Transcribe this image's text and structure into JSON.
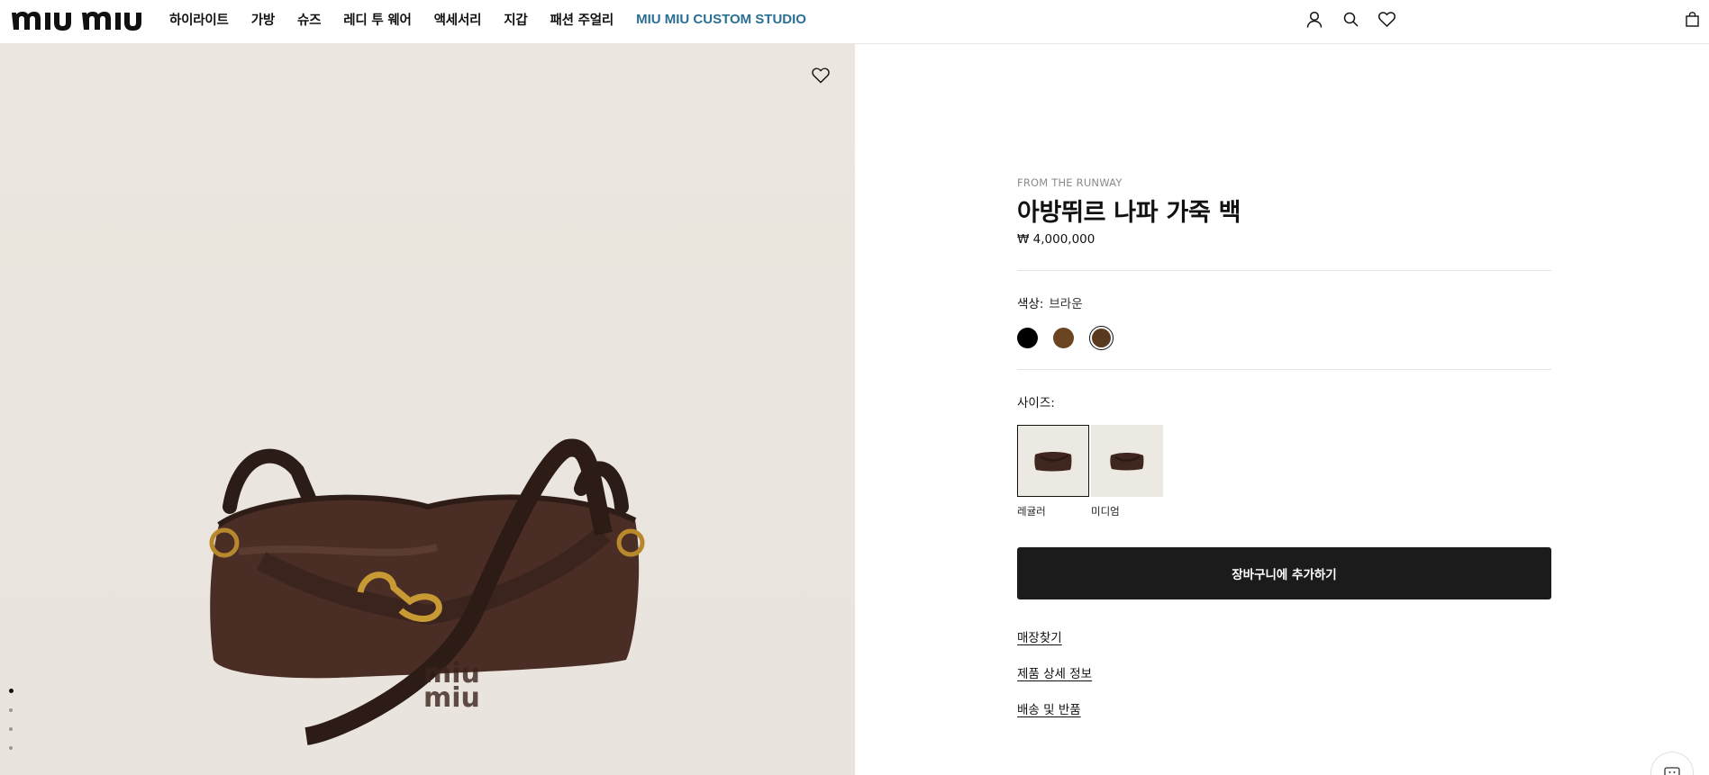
{
  "brand": {
    "logo_text": "miu miu"
  },
  "nav": {
    "items": [
      {
        "label": "하이라이트"
      },
      {
        "label": "가방"
      },
      {
        "label": "슈즈"
      },
      {
        "label": "레디 투 웨어"
      },
      {
        "label": "액세서리"
      },
      {
        "label": "지갑"
      },
      {
        "label": "패션 주얼리"
      },
      {
        "label": "MIU MIU CUSTOM STUDIO"
      }
    ],
    "accent_color": "#2b6f94"
  },
  "header_icons": [
    "account-icon",
    "search-icon",
    "wishlist-icon",
    "bag-icon"
  ],
  "gallery": {
    "dots_count": 4,
    "active_dot": 0,
    "background": "#ebe6df"
  },
  "product": {
    "eyebrow": "FROM THE RUNWAY",
    "title": "아방뛰르 나파 가죽 백",
    "price": "₩ 4,000,000",
    "color_label": "색상:",
    "color_value": "브라운",
    "swatches": [
      {
        "color": "#000000",
        "selected": false
      },
      {
        "color": "#6b4522",
        "selected": false
      },
      {
        "color": "#5a3a1f",
        "selected": true
      }
    ],
    "size_label": "사이즈:",
    "sizes": [
      {
        "label": "레귤러",
        "selected": true
      },
      {
        "label": "미디엄",
        "selected": false
      }
    ],
    "add_to_cart": "장바구니에 추가하기",
    "links": [
      {
        "label": "매장찾기"
      },
      {
        "label": "제품 상세 정보"
      },
      {
        "label": "배송 및 반품"
      }
    ]
  }
}
